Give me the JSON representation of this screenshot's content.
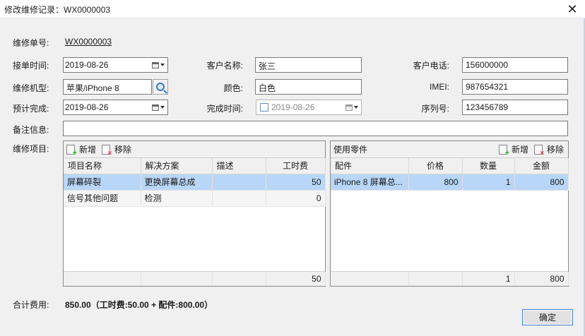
{
  "window": {
    "title": "修改维修记录：WX0000003"
  },
  "form": {
    "order_no_label": "维修单号:",
    "order_no": "WX0000003",
    "receive_time_label": "接单时间:",
    "receive_time": "2019-08-26",
    "customer_name_label": "客户名称:",
    "customer_name": "张三",
    "customer_phone_label": "客户电话:",
    "customer_phone": "156000000",
    "model_label": "维修机型:",
    "model": "苹果/iPhone 8",
    "color_label": "颜色:",
    "color": "白色",
    "imei_label": "IMEI:",
    "imei": "987654321",
    "expected_label": "预计完成:",
    "expected": "2019-08-26",
    "finish_time_label": "完成时间:",
    "finish_time": "2019-08-26",
    "serial_label": "序列号:",
    "serial": "123456789",
    "remark_label": "备注信息:",
    "remark": "",
    "items_label": "维修项目:"
  },
  "items_panel": {
    "add_label": "新增",
    "remove_label": "移除",
    "columns": [
      "项目名称",
      "解决方案",
      "描述",
      "工时费"
    ],
    "rows": [
      {
        "name": "屏幕碎裂",
        "solution": "更换屏幕总成",
        "desc": "",
        "fee": "50"
      },
      {
        "name": "信号其他问题",
        "solution": "检测",
        "desc": "",
        "fee": "0"
      }
    ],
    "total_fee": "50"
  },
  "parts_panel": {
    "title": "使用零件",
    "add_label": "新增",
    "remove_label": "移除",
    "columns": [
      "配件",
      "价格",
      "数量",
      "金额"
    ],
    "rows": [
      {
        "part": "iPhone 8 屏幕总...",
        "price": "800",
        "qty": "1",
        "amount": "800"
      }
    ],
    "total_qty": "1",
    "total_amount": "800"
  },
  "summary": {
    "label": "合计费用:",
    "value": "850.00（工时费:50.00 + 配件:800.00）"
  },
  "buttons": {
    "ok_label": "确定"
  }
}
